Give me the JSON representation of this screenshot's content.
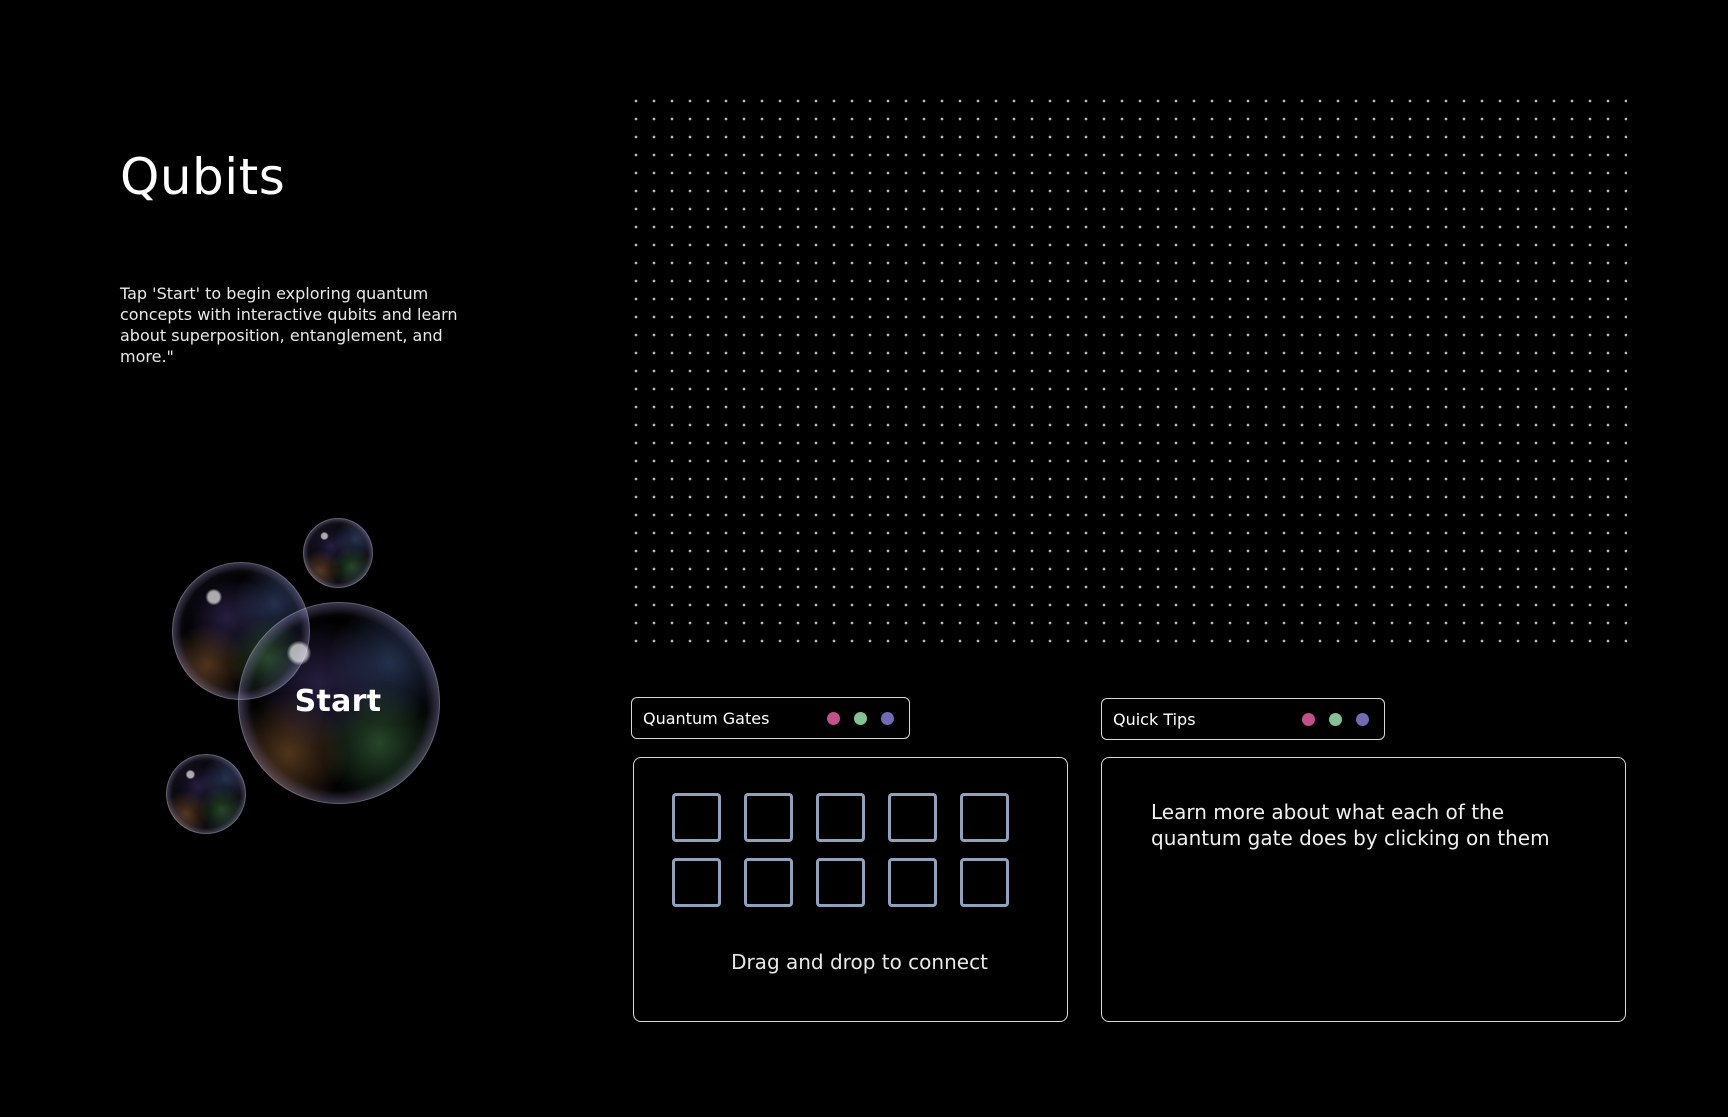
{
  "hero": {
    "title": "Qubits",
    "intro": "Tap 'Start' to begin exploring quantum concepts with interactive qubits and learn about superposition, entanglement, and more.\"",
    "start_label": "Start"
  },
  "gates_panel": {
    "header_label": "Quantum Gates",
    "slot_count": 10,
    "hint": "Drag and drop to connect"
  },
  "tips_panel": {
    "header_label": "Quick Tips",
    "text": "Learn more about what each of the quantum gate does by clicking on them"
  },
  "colors": {
    "background": "#000000",
    "dot_pink": "#c2508b",
    "dot_green": "#82c293",
    "dot_purple": "#6f6bb5",
    "gate_slot_border": "#8ea3bb",
    "panel_border": "#d7d7d7"
  },
  "icons": {
    "header_dots": [
      "pink-dot-icon",
      "green-dot-icon",
      "purple-dot-icon"
    ]
  }
}
